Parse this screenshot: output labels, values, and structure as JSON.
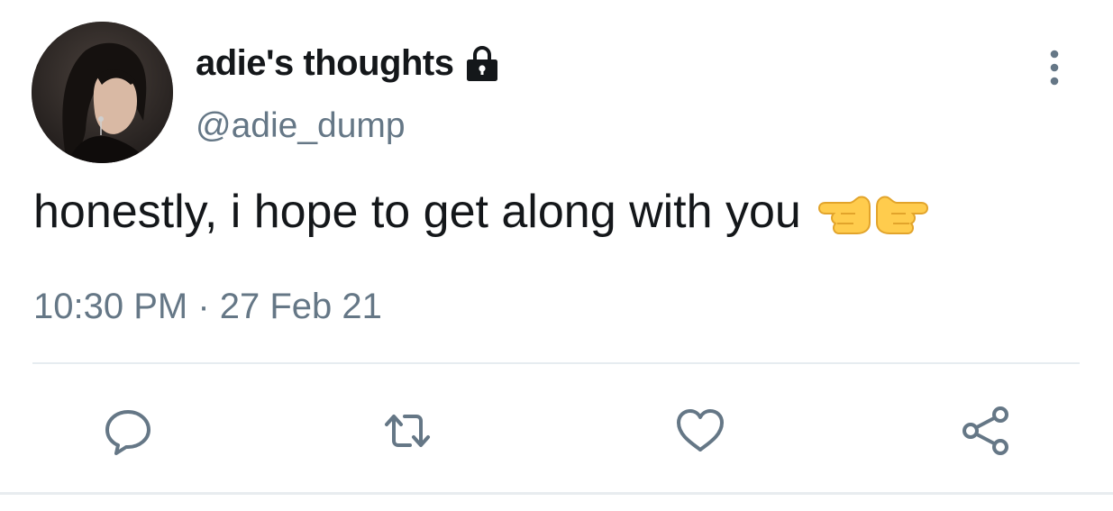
{
  "tweet": {
    "display_name": "adie's thoughts",
    "handle": "@adie_dump",
    "text": "honestly, i hope to get along with you",
    "timestamp": "10:30 PM · 27 Feb 21",
    "emojis": [
      "backhand-index-pointing-left",
      "backhand-index-pointing-right"
    ]
  },
  "icons": {
    "lock": "lock-icon",
    "more": "more-vertical-icon",
    "reply": "reply-icon",
    "retweet": "retweet-icon",
    "like": "heart-icon",
    "share": "share-icon"
  },
  "colors": {
    "text_primary": "#14171a",
    "text_secondary": "#657786",
    "divider": "#e6ecf0",
    "emoji_skin": "#ffcc4d"
  }
}
